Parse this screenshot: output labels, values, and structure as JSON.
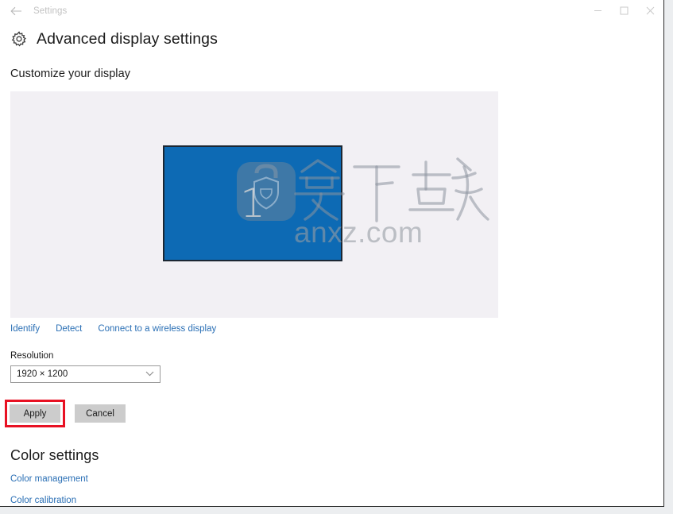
{
  "window": {
    "titlebar": {
      "back_icon": "back-arrow-icon",
      "title": "Settings",
      "minimize_label": "Minimize",
      "maximize_label": "Maximize",
      "close_label": "Close"
    }
  },
  "page": {
    "icon": "gear-icon",
    "title": "Advanced display settings",
    "section_heading": "Customize your display"
  },
  "display_preview": {
    "monitor_number": "1",
    "monitor_color": "#0d6ab4",
    "panel_color": "#f2f0f4",
    "links": [
      {
        "label": "Identify"
      },
      {
        "label": "Detect"
      },
      {
        "label": "Connect to a wireless display"
      }
    ]
  },
  "watermark": {
    "logo_icon": "briefcase-shield-icon",
    "cn_text": "安下载",
    "site": "anxz.com"
  },
  "resolution": {
    "label": "Resolution",
    "value": "1920 × 1200",
    "chevron_icon": "chevron-down-icon",
    "options": [
      "1920 × 1200"
    ]
  },
  "actions": {
    "apply_label": "Apply",
    "cancel_label": "Cancel",
    "highlight_color": "#e81123"
  },
  "color_settings": {
    "heading": "Color settings",
    "links": [
      {
        "label": "Color management"
      },
      {
        "label": "Color calibration"
      }
    ]
  },
  "theme": {
    "link_color": "#2a6fb5",
    "text_color": "#1b1b1b",
    "button_bg": "#cccccc"
  }
}
